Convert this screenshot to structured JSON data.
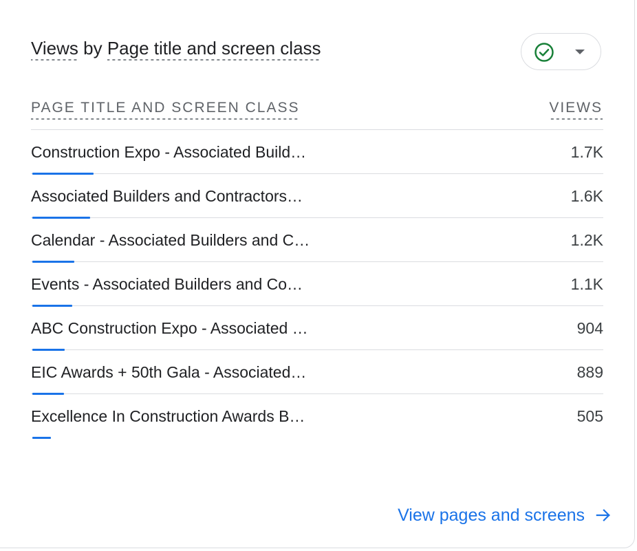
{
  "card": {
    "title_prefix": "Views",
    "title_by": " by ",
    "title_dimension": "Page title and screen class"
  },
  "status": {
    "icon": "check-circle-icon",
    "color": "#188038"
  },
  "table": {
    "dimension_header": "PAGE TITLE AND SCREEN CLASS",
    "metric_header": "VIEWS",
    "rows": [
      {
        "label": "Construction Expo - Associated Build…",
        "value": "1.7K",
        "fraction": 1.0
      },
      {
        "label": "Associated Builders and Contractors…",
        "value": "1.6K",
        "fraction": 0.94
      },
      {
        "label": "Calendar - Associated Builders and C…",
        "value": "1.2K",
        "fraction": 0.69
      },
      {
        "label": "Events - Associated Builders and Co…",
        "value": "1.1K",
        "fraction": 0.65
      },
      {
        "label": "ABC Construction Expo - Associated …",
        "value": "904",
        "fraction": 0.53
      },
      {
        "label": "EIC Awards + 50th Gala - Associated…",
        "value": "889",
        "fraction": 0.52
      },
      {
        "label": "Excellence In Construction Awards B…",
        "value": "505",
        "fraction": 0.3
      }
    ]
  },
  "footer": {
    "link_label": "View pages and screens",
    "icon": "arrow-right-icon"
  },
  "colors": {
    "accent": "#1a73e8",
    "success": "#188038"
  }
}
